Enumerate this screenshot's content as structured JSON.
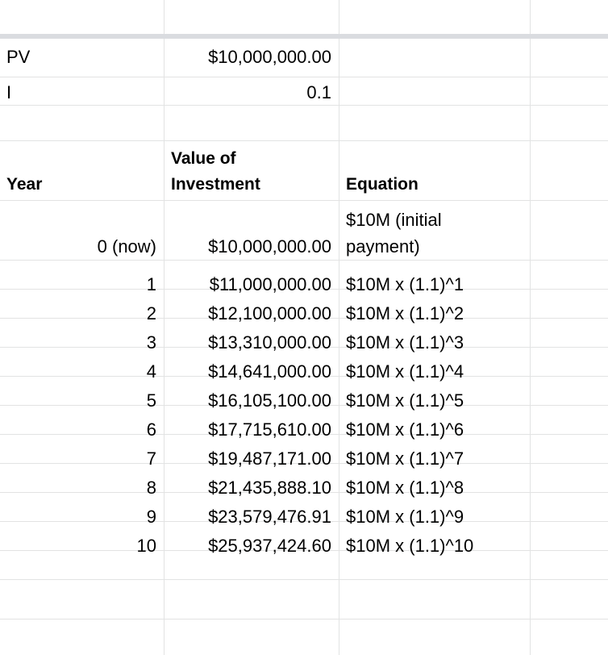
{
  "inputs": [
    {
      "label": "PV",
      "value": "$10,000,000.00"
    },
    {
      "label": "I",
      "value": "0.1"
    }
  ],
  "headers": {
    "year": "Year",
    "value_line1": "Value of",
    "value_line2": "Investment",
    "equation": "Equation"
  },
  "rows": [
    {
      "year": "0 (now)",
      "value": "$10,000,000.00",
      "eq_line1": "$10M (initial",
      "eq_line2": "payment)"
    },
    {
      "year": "1",
      "value": "$11,000,000.00",
      "equation": "$10M x (1.1)^1"
    },
    {
      "year": "2",
      "value": "$12,100,000.00",
      "equation": "$10M x (1.1)^2"
    },
    {
      "year": "3",
      "value": "$13,310,000.00",
      "equation": "$10M x (1.1)^3"
    },
    {
      "year": "4",
      "value": "$14,641,000.00",
      "equation": "$10M x (1.1)^4"
    },
    {
      "year": "5",
      "value": "$16,105,100.00",
      "equation": "$10M x (1.1)^5"
    },
    {
      "year": "6",
      "value": "$17,715,610.00",
      "equation": "$10M x (1.1)^6"
    },
    {
      "year": "7",
      "value": "$19,487,171.00",
      "equation": "$10M x (1.1)^7"
    },
    {
      "year": "8",
      "value": "$21,435,888.10",
      "equation": "$10M x (1.1)^8"
    },
    {
      "year": "9",
      "value": "$23,579,476.91",
      "equation": "$10M x (1.1)^9"
    },
    {
      "year": "10",
      "value": "$25,937,424.60",
      "equation": "$10M x (1.1)^10"
    }
  ],
  "colors": {
    "highlight": "#ffff3b",
    "gridline": "#e2e3e3",
    "freeze_bar": "#dadce0"
  }
}
